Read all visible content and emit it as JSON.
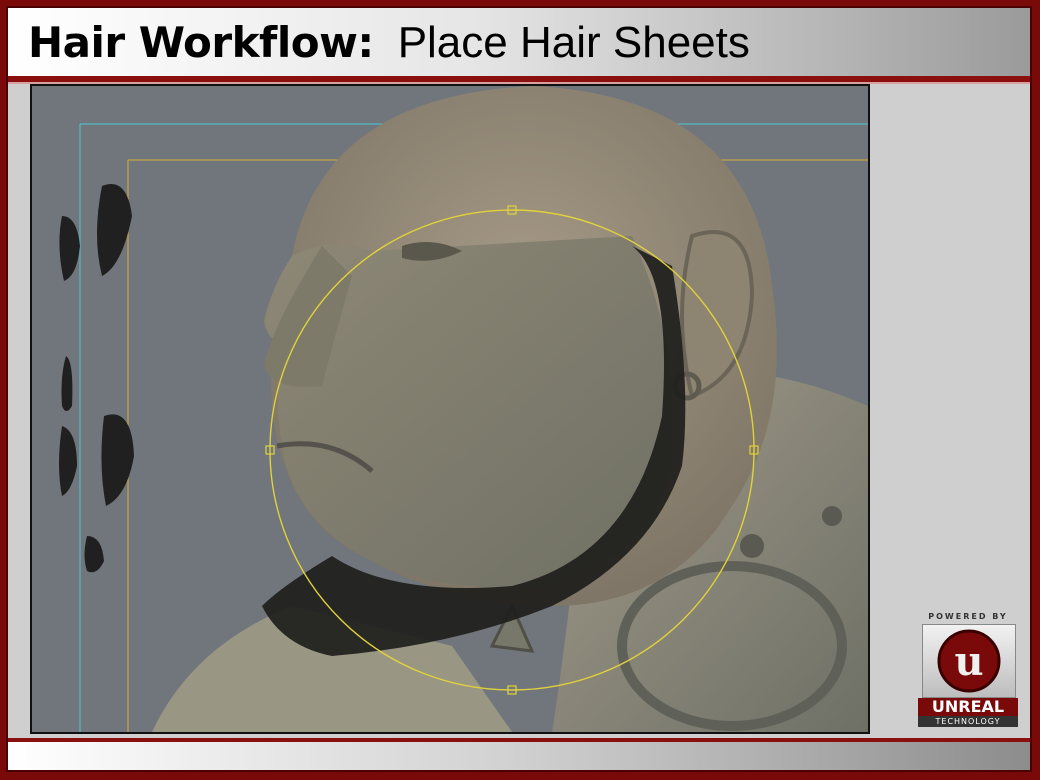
{
  "slide": {
    "title_bold": "Hair Workflow:",
    "title_rest": "Place Hair Sheets"
  },
  "viewport": {
    "content": "3D head model with beard hair sheets and a circular manipulator"
  },
  "logo": {
    "top_text": "POWERED BY",
    "word": "UNREAL",
    "sub_text": "TECHNOLOGY"
  },
  "colors": {
    "frame": "#7a0a0a",
    "accent_rule": "#8a0f0f",
    "viewport_bg": "#70767b",
    "manipulator": "#e0d23a",
    "safe_frame_outer": "#4ec9d4",
    "safe_frame_inner": "#d6b03a"
  }
}
